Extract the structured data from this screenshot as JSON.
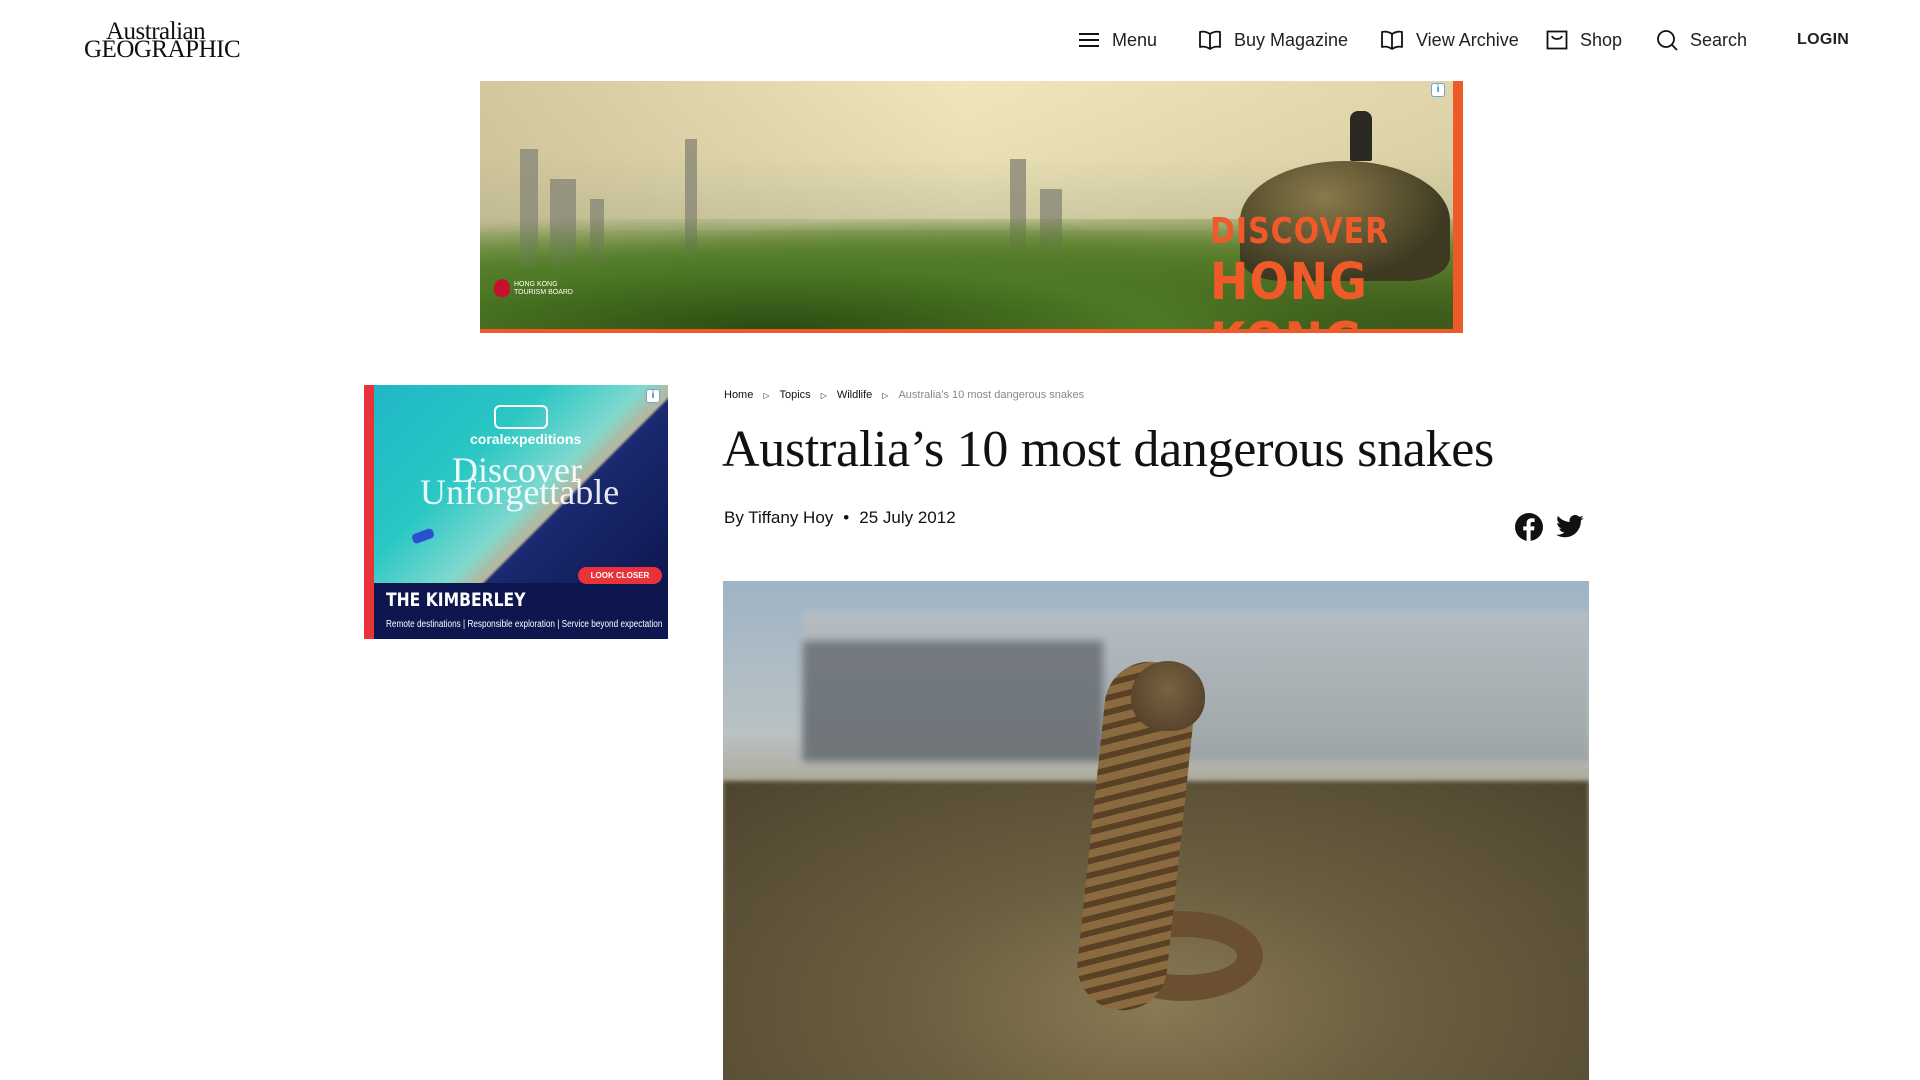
{
  "header": {
    "logo": {
      "line1": "Australian",
      "line2": "GEOGRAPHIC"
    },
    "nav": {
      "menu": "Menu",
      "buy_magazine": "Buy Magazine",
      "view_archive": "View Archive",
      "shop": "Shop",
      "search": "Search",
      "login": "LOGIN"
    }
  },
  "ads": {
    "banner": {
      "line1": "DISCOVER",
      "line2": "HONG KONG",
      "sponsor_line1": "HONG KONG",
      "sponsor_line2": "TOURISM BOARD",
      "adchoices": "i"
    },
    "sidebar": {
      "brand": "coralexpeditions",
      "headline1": "Discover",
      "headline2": "Unforgettable",
      "cta": "LOOK CLOSER",
      "title": "THE KIMBERLEY",
      "tagline": "Remote destinations | Responsible exploration | Service beyond expectation",
      "adchoices": "i"
    }
  },
  "breadcrumb": [
    "Home",
    "Topics",
    "Wildlife",
    "Australia’s 10 most dangerous snakes"
  ],
  "article": {
    "title": "Australia’s 10 most dangerous snakes",
    "author": "By Tiffany Hoy",
    "separator": "•",
    "date": "25 July 2012"
  },
  "share": {
    "facebook": "facebook-icon",
    "twitter": "twitter-icon"
  },
  "colors": {
    "ad_accent": "#f05a28",
    "sidebar_bg": "#0e1650",
    "sidebar_accent": "#e8333a"
  }
}
